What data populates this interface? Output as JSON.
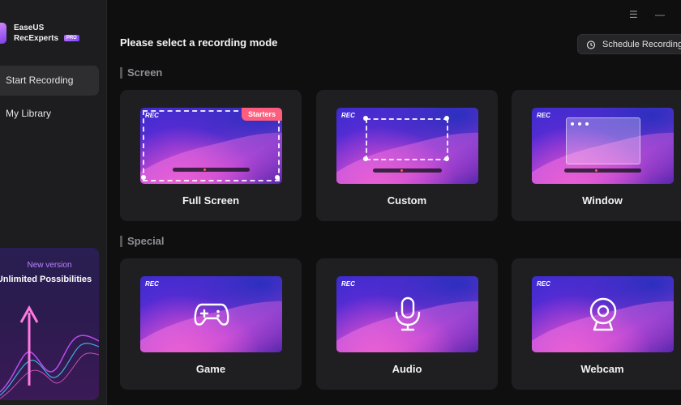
{
  "app": {
    "brand_line1": "EaseUS",
    "brand_line2": "RecExperts",
    "pro_label": "PRO"
  },
  "topbar": {
    "menu_icon": "menu-icon",
    "minimize_icon": "minimize-icon"
  },
  "sidebar": {
    "items": [
      {
        "label": "Start Recording",
        "active": true
      },
      {
        "label": "My Library",
        "active": false
      }
    ],
    "promo": {
      "kicker": "New version",
      "title": "Unlimited Possibilities"
    }
  },
  "main": {
    "title": "Please select a recording mode",
    "schedule_button": "Schedule Recording",
    "sections": [
      {
        "label": "Screen",
        "cards": [
          {
            "label": "Full Screen",
            "rec": "REC",
            "badge": "Starters"
          },
          {
            "label": "Custom",
            "rec": "REC"
          },
          {
            "label": "Window",
            "rec": "REC"
          }
        ]
      },
      {
        "label": "Special",
        "cards": [
          {
            "label": "Game",
            "rec": "REC",
            "icon": "gamepad-icon"
          },
          {
            "label": "Audio",
            "rec": "REC",
            "icon": "microphone-icon"
          },
          {
            "label": "Webcam",
            "rec": "REC",
            "icon": "webcam-icon"
          }
        ]
      }
    ]
  },
  "colors": {
    "background": "#0f0f10",
    "sidebar": "#1d1d1f",
    "card": "#1f1f21",
    "accent": "#7b3fe4",
    "badge": "#ff5d7d"
  }
}
